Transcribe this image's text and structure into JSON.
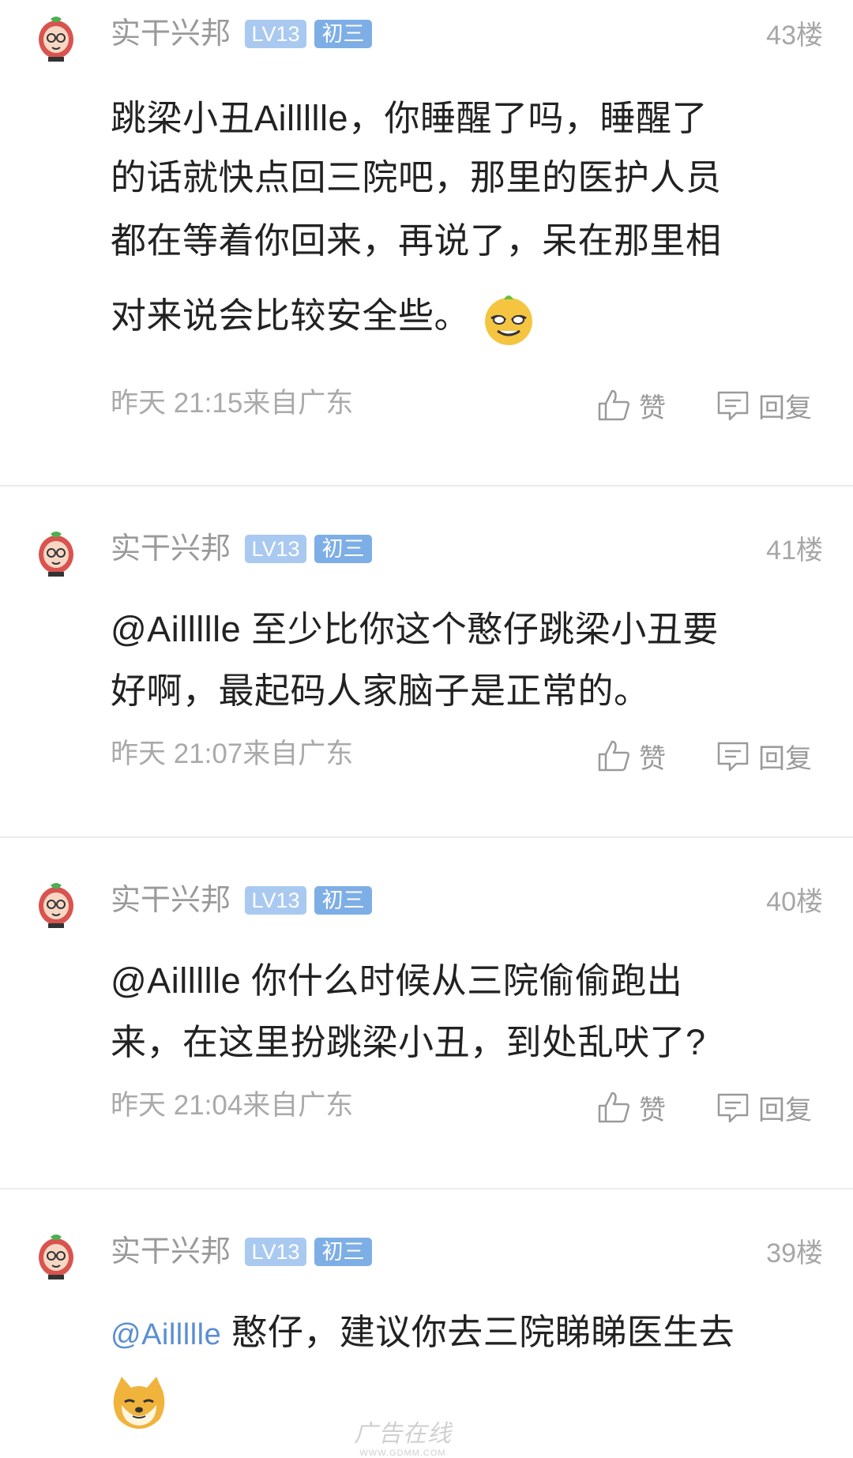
{
  "comments": [
    {
      "username": "实干兴邦",
      "level": "LV13",
      "grade": "初三",
      "floor": "43楼",
      "lines": [
        "跳梁小丑Aillllle，你睡醒了吗，睡醒了",
        "的话就快点回三院吧，那里的医护人员",
        "都在等着你回来，再说了，呆在那里相",
        "对来说会比较安全些。"
      ],
      "emoji": "grinning-bun-emoji",
      "time": "昨天 21:15来自广东",
      "like_label": "赞",
      "reply_label": "回复"
    },
    {
      "username": "实干兴邦",
      "level": "LV13",
      "grade": "初三",
      "floor": "41楼",
      "lines": [
        "@Aillllle 至少比你这个憨仔跳梁小丑要",
        "好啊，最起码人家脑子是正常的。"
      ],
      "time": "昨天 21:07来自广东",
      "like_label": "赞",
      "reply_label": "回复"
    },
    {
      "username": "实干兴邦",
      "level": "LV13",
      "grade": "初三",
      "floor": "40楼",
      "lines": [
        "@Aillllle 你什么时候从三院偷偷跑出",
        "来，在这里扮跳梁小丑，到处乱吠了?"
      ],
      "time": "昨天 21:04来自广东",
      "like_label": "赞",
      "reply_label": "回复"
    },
    {
      "username": "实干兴邦",
      "level": "LV13",
      "grade": "初三",
      "floor": "39楼",
      "mention": "@Aillllle",
      "text": "憨仔，建议你去三院睇睇医生去",
      "emoji": "doge-emoji"
    }
  ],
  "watermark": "广告在线",
  "watermark_url": "WWW.GDMM.COM",
  "colors": {
    "mention": "#5b8ed1",
    "badge_lv": "#a9c9f0",
    "badge_grade": "#7eaee6"
  }
}
